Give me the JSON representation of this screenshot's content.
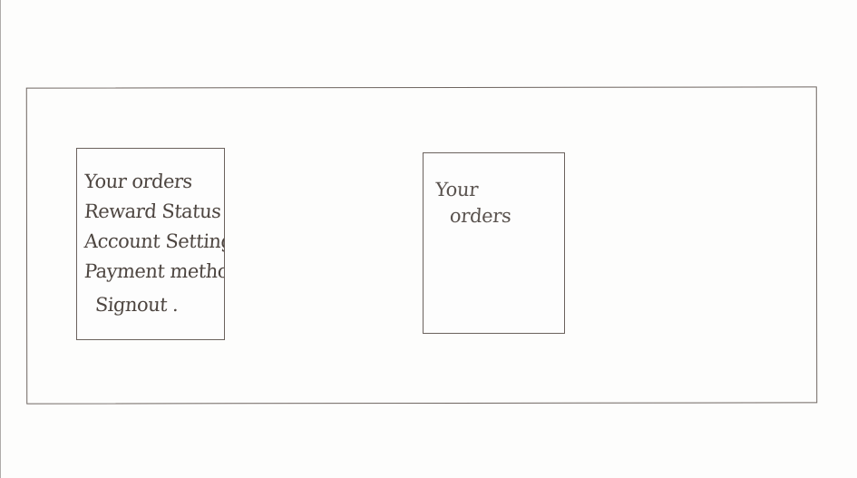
{
  "menu": {
    "items": [
      {
        "label": "Your orders"
      },
      {
        "label": "Reward Status"
      },
      {
        "label": "Account Settings"
      },
      {
        "label": "Payment methods"
      },
      {
        "label": "Signout ."
      }
    ]
  },
  "content": {
    "title_line1": "Your",
    "title_line2": "orders"
  }
}
